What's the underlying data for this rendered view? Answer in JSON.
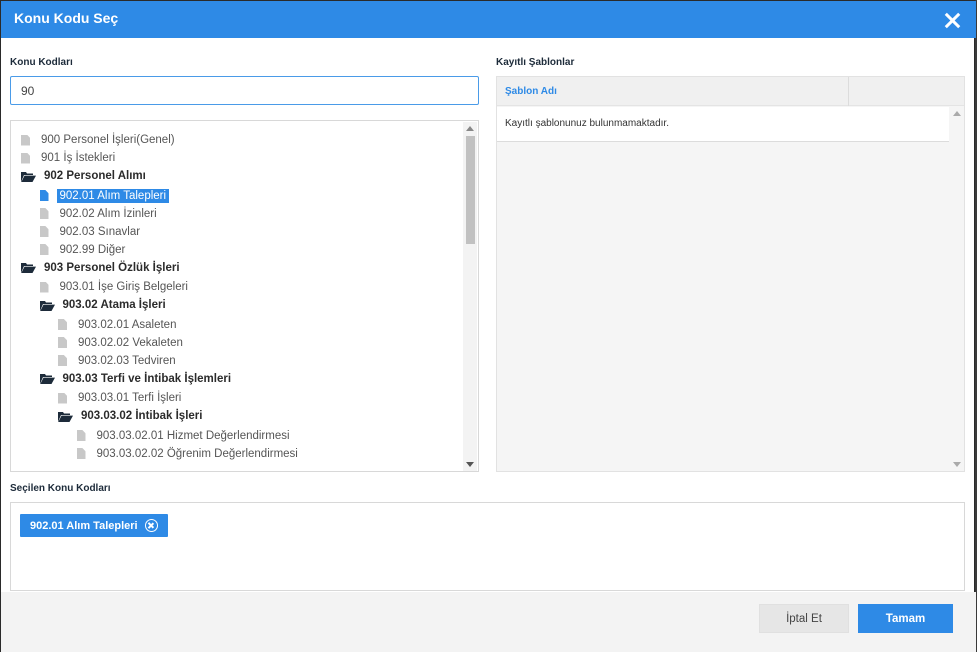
{
  "dialog": {
    "title": "Konu Kodu Seç"
  },
  "left": {
    "label": "Konu Kodları",
    "search_value": "90",
    "tree": [
      {
        "text": "900 Personel İşleri(Genel)",
        "type": "doc",
        "level": 0
      },
      {
        "text": "901 İş İstekleri",
        "type": "doc",
        "level": 0
      },
      {
        "text": "902 Personel Alımı",
        "type": "folder",
        "level": 0
      },
      {
        "text": "902.01 Alım Talepleri",
        "type": "doc",
        "level": 1,
        "selected": true
      },
      {
        "text": "902.02 Alım İzinleri",
        "type": "doc",
        "level": 1
      },
      {
        "text": "902.03 Sınavlar",
        "type": "doc",
        "level": 1
      },
      {
        "text": "902.99 Diğer",
        "type": "doc",
        "level": 1
      },
      {
        "text": "903 Personel Özlük İşleri",
        "type": "folder",
        "level": 0
      },
      {
        "text": "903.01 İşe Giriş Belgeleri",
        "type": "doc",
        "level": 1
      },
      {
        "text": "903.02 Atama İşleri",
        "type": "folder",
        "level": 1
      },
      {
        "text": "903.02.01 Asaleten",
        "type": "doc",
        "level": 2
      },
      {
        "text": "903.02.02 Vekaleten",
        "type": "doc",
        "level": 2
      },
      {
        "text": "903.02.03 Tedviren",
        "type": "doc",
        "level": 2
      },
      {
        "text": "903.03 Terfi ve İntibak İşlemleri",
        "type": "folder",
        "level": 1
      },
      {
        "text": "903.03.01 Terfi İşleri",
        "type": "doc",
        "level": 2
      },
      {
        "text": "903.03.02 İntibak İşleri",
        "type": "folder",
        "level": 2
      },
      {
        "text": "903.03.02.01 Hizmet Değerlendirmesi",
        "type": "doc",
        "level": 3
      },
      {
        "text": "903.03.02.02 Öğrenim Değerlendirmesi",
        "type": "doc",
        "level": 3
      }
    ]
  },
  "right": {
    "label": "Kayıtlı Şablonlar",
    "column_header": "Şablon Adı",
    "empty_message": "Kayıtlı şablonunuz bulunmamaktadır."
  },
  "selected": {
    "label": "Seçilen Konu Kodları",
    "chips": [
      "902.01 Alım Talepleri"
    ]
  },
  "footer": {
    "cancel_label": "İptal Et",
    "ok_label": "Tamam"
  },
  "colors": {
    "accent": "#2e8ae6",
    "folder_icon": "#1d2b3a",
    "doc_icon": "#c8c8c8"
  }
}
